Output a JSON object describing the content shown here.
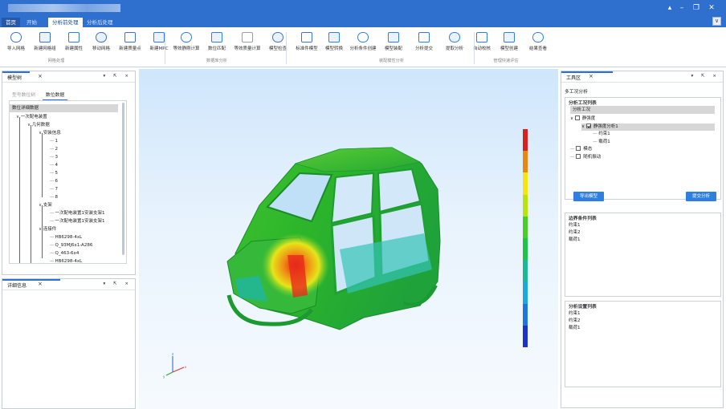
{
  "titlebar": {
    "controls": [
      "▴",
      "–",
      "❐",
      "✕"
    ]
  },
  "tabs": [
    {
      "label": "首页",
      "active": false
    },
    {
      "label": "开始",
      "active": false
    },
    {
      "label": "分析前处理",
      "active": true
    },
    {
      "label": "分析后处理",
      "active": false
    }
  ],
  "ribbon": {
    "buttons": [
      {
        "label": "导入网格",
        "icon": "import-mesh-icon"
      },
      {
        "label": "新建网格组",
        "icon": "mesh-group-icon"
      },
      {
        "label": "新建属性",
        "icon": "property-icon"
      },
      {
        "label": "移动网格",
        "icon": "move-mesh-icon"
      },
      {
        "label": "新建质量点",
        "icon": "mass-point-icon"
      },
      {
        "label": "新建MPC",
        "icon": "mpc-icon"
      },
      {
        "label": "等效静刚计算",
        "icon": "static-stiffness-icon"
      },
      {
        "label": "数位匹配",
        "icon": "digit-match-icon"
      },
      {
        "label": "等效质量计算",
        "icon": "equivalent-mass-icon"
      },
      {
        "label": "模型检查",
        "icon": "model-check-icon"
      },
      {
        "label": "标准件模型",
        "icon": "standard-part-icon"
      },
      {
        "label": "模型转换",
        "icon": "model-convert-icon"
      },
      {
        "label": "分析条件创建",
        "icon": "condition-create-icon"
      },
      {
        "label": "模型装配",
        "icon": "model-assembly-icon"
      },
      {
        "label": "分析提交",
        "icon": "analysis-submit-icon"
      },
      {
        "label": "提取分析",
        "icon": "extract-analysis-icon"
      },
      {
        "label": "自动校核",
        "icon": "auto-check-icon"
      },
      {
        "label": "模型创建",
        "icon": "model-create-icon"
      },
      {
        "label": "结果查看",
        "icon": "result-view-icon"
      }
    ],
    "groups": [
      "网格处理",
      "数据库分析",
      "装配模性分析",
      "管理快速评估"
    ]
  },
  "model_tree": {
    "title": "模型树",
    "subtabs": [
      {
        "label": "型号数位树",
        "active": false
      },
      {
        "label": "数位数据",
        "active": true
      }
    ],
    "header": "数位详细数据",
    "rows": [
      {
        "label": "一次配电装置",
        "depth": 1,
        "expander": "∨"
      },
      {
        "label": "几何数据",
        "depth": 2,
        "expander": "∨"
      },
      {
        "label": "安装信息",
        "depth": 3,
        "expander": "∨"
      },
      {
        "label": "1",
        "depth": 4,
        "expander": ""
      },
      {
        "label": "2",
        "depth": 4,
        "expander": ""
      },
      {
        "label": "3",
        "depth": 4,
        "expander": ""
      },
      {
        "label": "4",
        "depth": 4,
        "expander": ""
      },
      {
        "label": "5",
        "depth": 4,
        "expander": ""
      },
      {
        "label": "6",
        "depth": 4,
        "expander": ""
      },
      {
        "label": "7",
        "depth": 4,
        "expander": ""
      },
      {
        "label": "8",
        "depth": 4,
        "expander": ""
      },
      {
        "label": "支架",
        "depth": 3,
        "expander": "∨"
      },
      {
        "label": "一次配电装置1安装支架1",
        "depth": 4,
        "expander": ""
      },
      {
        "label": "一次配电装置1安装支架1",
        "depth": 4,
        "expander": ""
      },
      {
        "label": "连接件",
        "depth": 3,
        "expander": "∨"
      },
      {
        "label": "HB6298-4xL",
        "depth": 4,
        "expander": ""
      },
      {
        "label": "Q_93MJ6x1-A286",
        "depth": 4,
        "expander": ""
      },
      {
        "label": "Q_463-6x4",
        "depth": 4,
        "expander": ""
      },
      {
        "label": "HB6298-4xL",
        "depth": 4,
        "expander": ""
      }
    ]
  },
  "details": {
    "title": "详细信息"
  },
  "toolbox": {
    "title": "工具区",
    "subtitle": "多工况分析",
    "case_list_title": "分析工况列表",
    "case_header": "分析工况",
    "cases": [
      {
        "label": "静强度",
        "depth": 1,
        "checked": false,
        "expander": "∨",
        "selected": false
      },
      {
        "label": "静强度分析1",
        "depth": 2,
        "checked": true,
        "expander": "∨",
        "selected": true
      },
      {
        "label": "约束1",
        "depth": 3,
        "checked": null,
        "expander": "",
        "selected": false
      },
      {
        "label": "载荷1",
        "depth": 3,
        "checked": null,
        "expander": "",
        "selected": false
      },
      {
        "label": "模态",
        "depth": 1,
        "checked": false,
        "expander": "",
        "selected": false
      },
      {
        "label": "随机振动",
        "depth": 1,
        "checked": false,
        "expander": "",
        "selected": false
      }
    ],
    "export_button": "导出模型",
    "submit_button": "提交分析",
    "bc_title": "边界条件列表",
    "bc_items": [
      "约束1",
      "约束2",
      "载荷1"
    ],
    "setting_title": "分析设置列表",
    "setting_items": [
      "约束1",
      "约束2",
      "载荷1"
    ]
  },
  "legend_colors": [
    "#d8201c",
    "#e8880f",
    "#f2e510",
    "#b9e30d",
    "#45cf27",
    "#1fc447",
    "#19b995",
    "#1aa9d8",
    "#1f74de",
    "#1c32c8"
  ],
  "colors": {
    "accent": "#2f6fcd",
    "button": "#2f7fe0"
  }
}
